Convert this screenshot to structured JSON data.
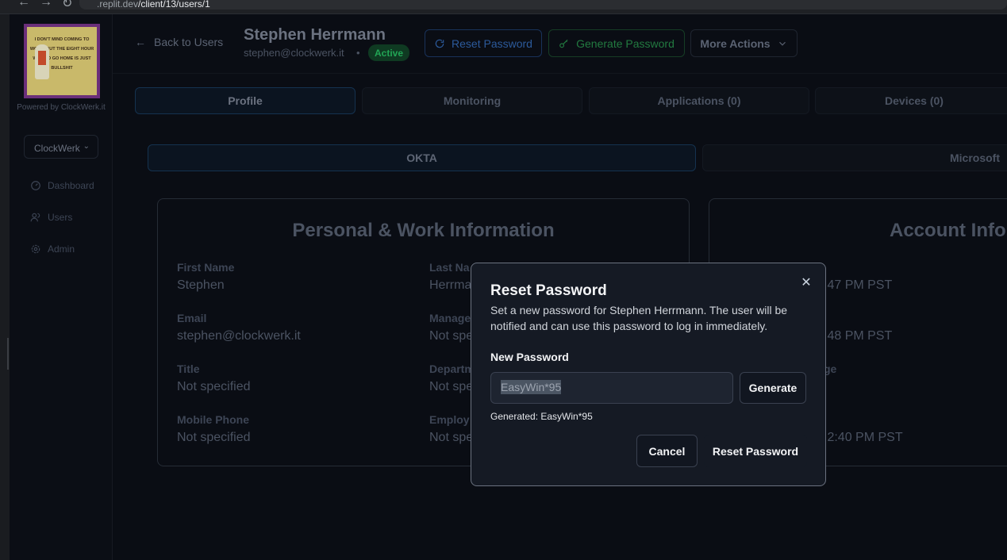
{
  "browser": {
    "url_prefix": ".replit.dev",
    "url_path": "/client/13/users/1"
  },
  "sidebar": {
    "powered_by": "Powered by ClockWerk.it",
    "org_selector": "ClockWerk",
    "logo_text": "I DON'T MIND COMING TO WORK, BUT THE EIGHT HOUR WAIT TO GO HOME IS JUST BULLSHIT",
    "items": [
      {
        "label": "Dashboard",
        "icon": "gauge-icon"
      },
      {
        "label": "Users",
        "icon": "users-icon"
      },
      {
        "label": "Admin",
        "icon": "gear-icon"
      }
    ]
  },
  "header": {
    "back_label": "Back to Users",
    "user_name": "Stephen Herrmann",
    "user_email": "stephen@clockwerk.it",
    "separator": "•",
    "status": "Active",
    "reset_password_label": "Reset Password",
    "generate_password_label": "Generate Password",
    "more_actions_label": "More Actions"
  },
  "tabs": [
    {
      "label": "Profile",
      "active": true
    },
    {
      "label": "Monitoring",
      "active": false
    },
    {
      "label": "Applications (0)",
      "active": false
    },
    {
      "label": "Devices (0)",
      "active": false
    }
  ],
  "subtabs": [
    {
      "label": "OKTA",
      "active": true
    },
    {
      "label": "Microsoft",
      "active": false
    }
  ],
  "personal_card": {
    "title": "Personal & Work Information",
    "fields": [
      {
        "label": "First Name",
        "value": "Stephen"
      },
      {
        "label": "Email",
        "value": "stephen@clockwerk.it"
      },
      {
        "label": "Title",
        "value": "Not specified"
      },
      {
        "label": "Mobile Phone",
        "value": "Not specified"
      },
      {
        "label": "Last Na",
        "value": "Herrma"
      },
      {
        "label": "Manage",
        "value": "Not spe"
      },
      {
        "label": "Departm",
        "value": "Not spe"
      },
      {
        "label": "Employ",
        "value": "Not spe"
      }
    ]
  },
  "account_card": {
    "title": "Account Inforn",
    "values": [
      ":47 PM PST",
      ":48 PM PST",
      "ge",
      ":2:40 PM PST"
    ]
  },
  "modal": {
    "title": "Reset Password",
    "description": "Set a new password for Stephen Herrmann. The user will be notified and can use this password to log in immediately.",
    "field_label": "New Password",
    "password_value": "EasyWin*95",
    "generate_label": "Generate",
    "generated_note": "Generated: EasyWin*95",
    "cancel_label": "Cancel",
    "submit_label": "Reset Password",
    "close_icon": "close-icon"
  },
  "colors": {
    "background": "#0a0d14",
    "modal_bg": "#151a24",
    "active_badge": "#22a555",
    "reset_accent": "#2c5a9b",
    "generate_accent": "#227a40"
  }
}
